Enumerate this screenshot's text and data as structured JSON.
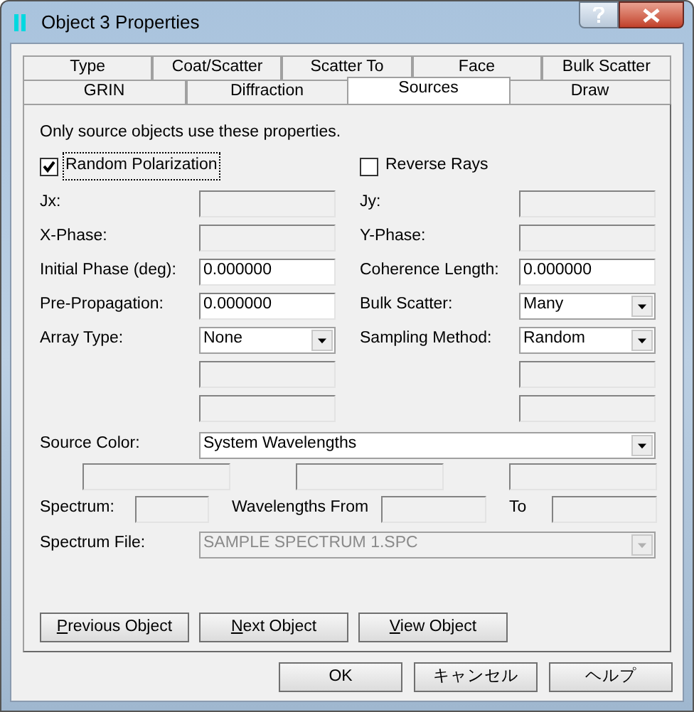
{
  "window": {
    "title": "Object 3 Properties"
  },
  "tabs": [
    [
      {
        "label": "Type",
        "selected": false
      },
      {
        "label": "Coat/Scatter",
        "selected": false
      },
      {
        "label": "Scatter To",
        "selected": false
      },
      {
        "label": "Face",
        "selected": false
      },
      {
        "label": "Bulk Scatter",
        "selected": false
      }
    ],
    [
      {
        "label": "GRIN",
        "selected": false
      },
      {
        "label": "Diffraction",
        "selected": false
      },
      {
        "label": "Sources",
        "selected": true
      },
      {
        "label": "Draw",
        "selected": false
      }
    ]
  ],
  "note": "Only source objects use these properties.",
  "checkboxes": [
    {
      "label": "Random Polarization",
      "checked": true,
      "focused": true
    },
    {
      "label": "Reverse Rays",
      "checked": false,
      "focused": false
    }
  ],
  "rows": [
    [
      {
        "label": "Jx:",
        "kind": "text",
        "disabled": true
      },
      {
        "label": "Jy:",
        "kind": "text",
        "disabled": true
      }
    ],
    [
      {
        "label": "X-Phase:",
        "kind": "text",
        "disabled": true
      },
      {
        "label": "Y-Phase:",
        "kind": "text",
        "disabled": true
      }
    ],
    [
      {
        "label": "Initial Phase (deg):",
        "kind": "text",
        "disabled": false,
        "value": "0.000000"
      },
      {
        "label": "Coherence Length:",
        "kind": "text",
        "disabled": false,
        "value": "0.000000"
      }
    ],
    [
      {
        "label": "Pre-Propagation:",
        "kind": "text",
        "disabled": false,
        "value": "0.000000"
      },
      {
        "label": "Bulk Scatter:",
        "kind": "dropdown",
        "disabled": false,
        "value": "Many"
      }
    ],
    [
      {
        "label": "Array Type:",
        "kind": "dropdown",
        "disabled": false,
        "value": "None"
      },
      {
        "label": "Sampling Method:",
        "kind": "dropdown",
        "disabled": false,
        "value": "Random"
      }
    ],
    [
      {
        "kind": "text",
        "disabled": true
      },
      {
        "kind": "text",
        "disabled": true
      }
    ],
    [
      {
        "kind": "text",
        "disabled": true
      },
      {
        "kind": "text",
        "disabled": true
      }
    ]
  ],
  "source_color": {
    "label": "Source Color:",
    "value": "System Wavelengths",
    "disabled": false
  },
  "color_fields": [
    {
      "disabled": true
    },
    {
      "disabled": true
    },
    {
      "disabled": true
    }
  ],
  "spectrum": {
    "label": "Spectrum:",
    "from_label": "Wavelengths From",
    "to_label": "To",
    "fields": [
      {
        "disabled": true
      },
      {
        "disabled": true
      },
      {
        "disabled": true
      }
    ]
  },
  "spectrum_file": {
    "label": "Spectrum File:",
    "value": "SAMPLE SPECTRUM 1.SPC",
    "disabled": true
  },
  "object_buttons": [
    "Previous Object",
    "Next Object",
    "View Object"
  ],
  "dialog_buttons": [
    "OK",
    "キャンセル",
    "ヘルプ"
  ]
}
